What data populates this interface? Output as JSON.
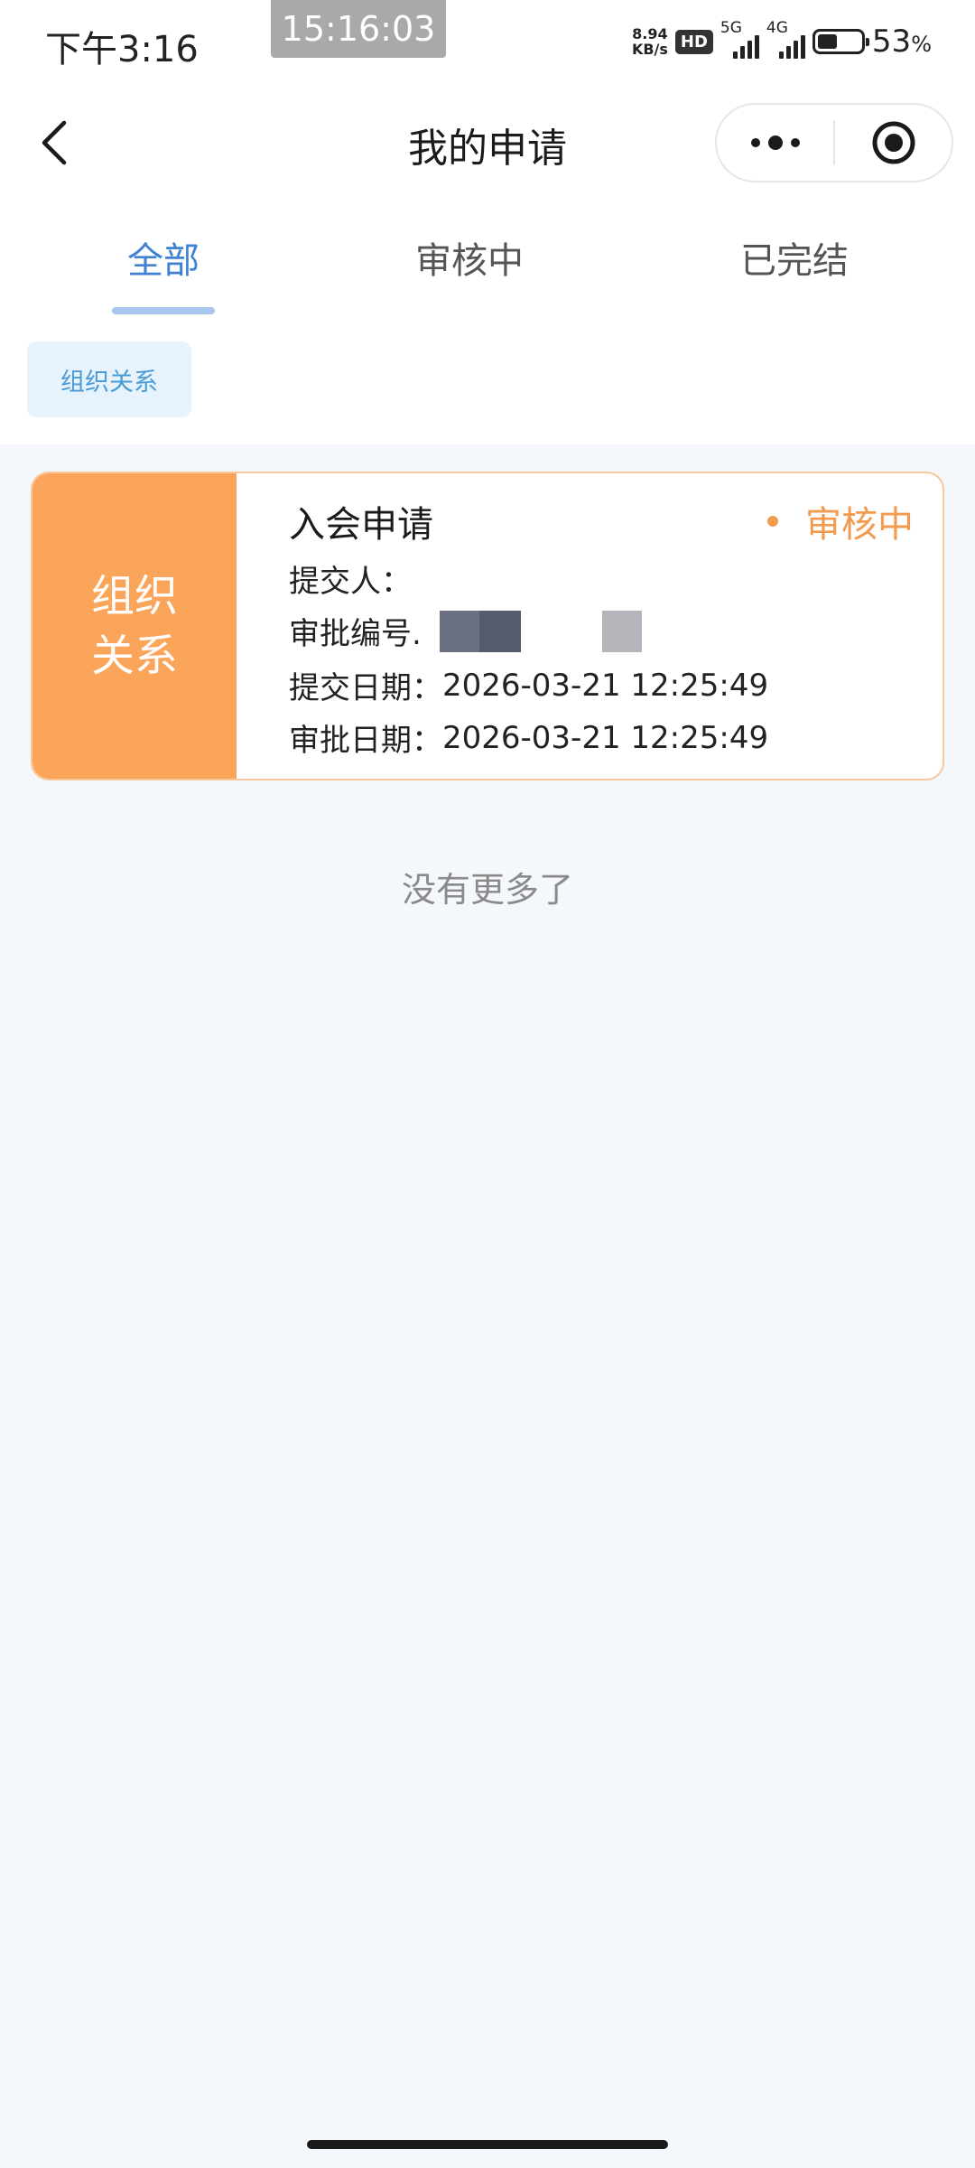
{
  "status_bar": {
    "time": "下午3:16",
    "overlay_clock": "15:16:03",
    "net_speed_value": "8.94",
    "net_speed_unit": "KB/s",
    "hd_badge": "HD",
    "network_1": "5G",
    "network_2": "4G",
    "battery_percent": "53",
    "battery_percent_sign": "%",
    "battery_level": 0.53
  },
  "nav": {
    "title": "我的申请",
    "back_icon": "chevron-left-icon",
    "more_icon": "more-dots-icon",
    "close_icon": "target-circle-icon"
  },
  "tabs": [
    {
      "label": "全部",
      "active": true
    },
    {
      "label": "审核中",
      "active": false
    },
    {
      "label": "已完结",
      "active": false
    }
  ],
  "filter": {
    "chip_label": "组织关系"
  },
  "application": {
    "category": "组织关系",
    "title": "入会申请",
    "status": "审核中",
    "submitter_label": "提交人：",
    "submitter_value": "",
    "approval_no_label": "审批编号.",
    "submit_date_label": "提交日期：",
    "submit_date_value": "2026-03-21 12:25:49",
    "approve_date_label": "审批日期：",
    "approve_date_value": "2026-03-21 12:25:49"
  },
  "list_end_text": "没有更多了",
  "colors": {
    "accent_blue": "#3f82d3",
    "card_orange": "#fba55b",
    "status_orange": "#f29a4e",
    "background": "#f4f7fb"
  }
}
